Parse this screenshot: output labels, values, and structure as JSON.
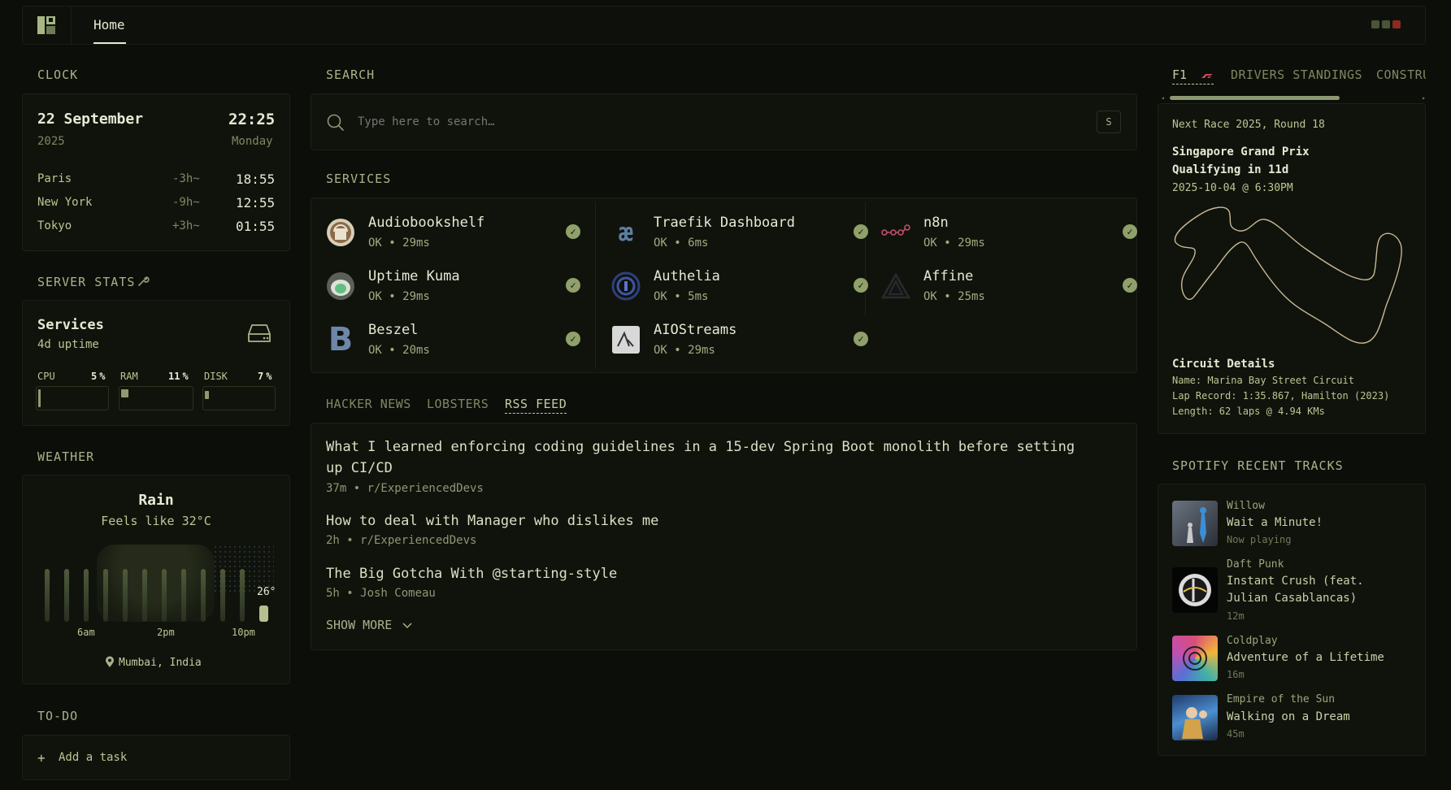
{
  "nav": {
    "home_label": "Home"
  },
  "colors": {
    "accent": "#8fa06a",
    "background": "#0c0e09",
    "panel": "#10130c"
  },
  "clock": {
    "section_title": "CLOCK",
    "date": "22 September",
    "year": "2025",
    "time": "22:25",
    "weekday": "Monday",
    "zones": [
      {
        "city": "Paris",
        "offset": "-3h~",
        "time": "18:55"
      },
      {
        "city": "New York",
        "offset": "-9h~",
        "time": "12:55"
      },
      {
        "city": "Tokyo",
        "offset": "+3h~",
        "time": "01:55"
      }
    ]
  },
  "server_stats": {
    "section_title": "SERVER STATS",
    "title": "Services",
    "uptime": "4d uptime",
    "cpu": {
      "label": "CPU",
      "value": "5",
      "unit": "%"
    },
    "ram": {
      "label": "RAM",
      "value": "11",
      "unit": "%"
    },
    "disk": {
      "label": "DISK",
      "value": "7",
      "unit": "%"
    }
  },
  "weather": {
    "section_title": "WEATHER",
    "condition": "Rain",
    "feels_like": "Feels like 32°C",
    "current_temp": "26°",
    "labels": [
      "6am",
      "2pm",
      "10pm"
    ],
    "location": "Mumbai, India"
  },
  "todo": {
    "section_title": "TO-DO",
    "add_label": "Add a task"
  },
  "search": {
    "section_title": "SEARCH",
    "placeholder": "Type here to search…",
    "shortcut": "S"
  },
  "services": {
    "section_title": "SERVICES",
    "items": [
      {
        "name": "Audiobookshelf",
        "status": "OK • 29ms"
      },
      {
        "name": "Traefik Dashboard",
        "status": "OK • 6ms"
      },
      {
        "name": "n8n",
        "status": "OK • 29ms"
      },
      {
        "name": "Uptime Kuma",
        "status": "OK • 29ms"
      },
      {
        "name": "Authelia",
        "status": "OK • 5ms"
      },
      {
        "name": "Affine",
        "status": "OK • 25ms"
      },
      {
        "name": "Beszel",
        "status": "OK • 20ms"
      },
      {
        "name": "AIOStreams",
        "status": "OK • 29ms"
      }
    ]
  },
  "feeds": {
    "tabs": [
      "HACKER NEWS",
      "LOBSTERS",
      "RSS FEED"
    ],
    "active_tab": "RSS FEED",
    "items": [
      {
        "title": "What I learned enforcing coding guidelines in a 15-dev Spring Boot monolith before setting up CI/CD",
        "meta": "37m • r/ExperiencedDevs"
      },
      {
        "title": "How to deal with Manager who dislikes me",
        "meta": "2h • r/ExperiencedDevs"
      },
      {
        "title": "The Big Gotcha With @starting-style",
        "meta": "5h • Josh Comeau"
      }
    ],
    "show_more": "SHOW MORE"
  },
  "f1": {
    "tabs": [
      "F1",
      "DRIVERS STANDINGS",
      "CONSTRU"
    ],
    "next_race": "Next Race 2025, Round 18",
    "race_name": "Singapore Grand Prix",
    "session": "Qualifying in 11d",
    "datetime": "2025-10-04 @ 6:30PM",
    "details_title": "Circuit Details",
    "circuit": "Name: Marina Bay Street Circuit",
    "lap_record": "Lap Record: 1:35.867, Hamilton (2023)",
    "length": "Length: 62 laps @ 4.94 KMs"
  },
  "spotify": {
    "section_title": "SPOTIFY RECENT TRACKS",
    "tracks": [
      {
        "artist": "Willow",
        "title": "Wait a Minute!",
        "when": "Now playing"
      },
      {
        "artist": "Daft Punk",
        "title": "Instant Crush (feat. Julian Casablancas)",
        "when": "12m"
      },
      {
        "artist": "Coldplay",
        "title": "Adventure of a Lifetime",
        "when": "16m"
      },
      {
        "artist": "Empire of the Sun",
        "title": "Walking on a Dream",
        "when": "45m"
      }
    ]
  }
}
